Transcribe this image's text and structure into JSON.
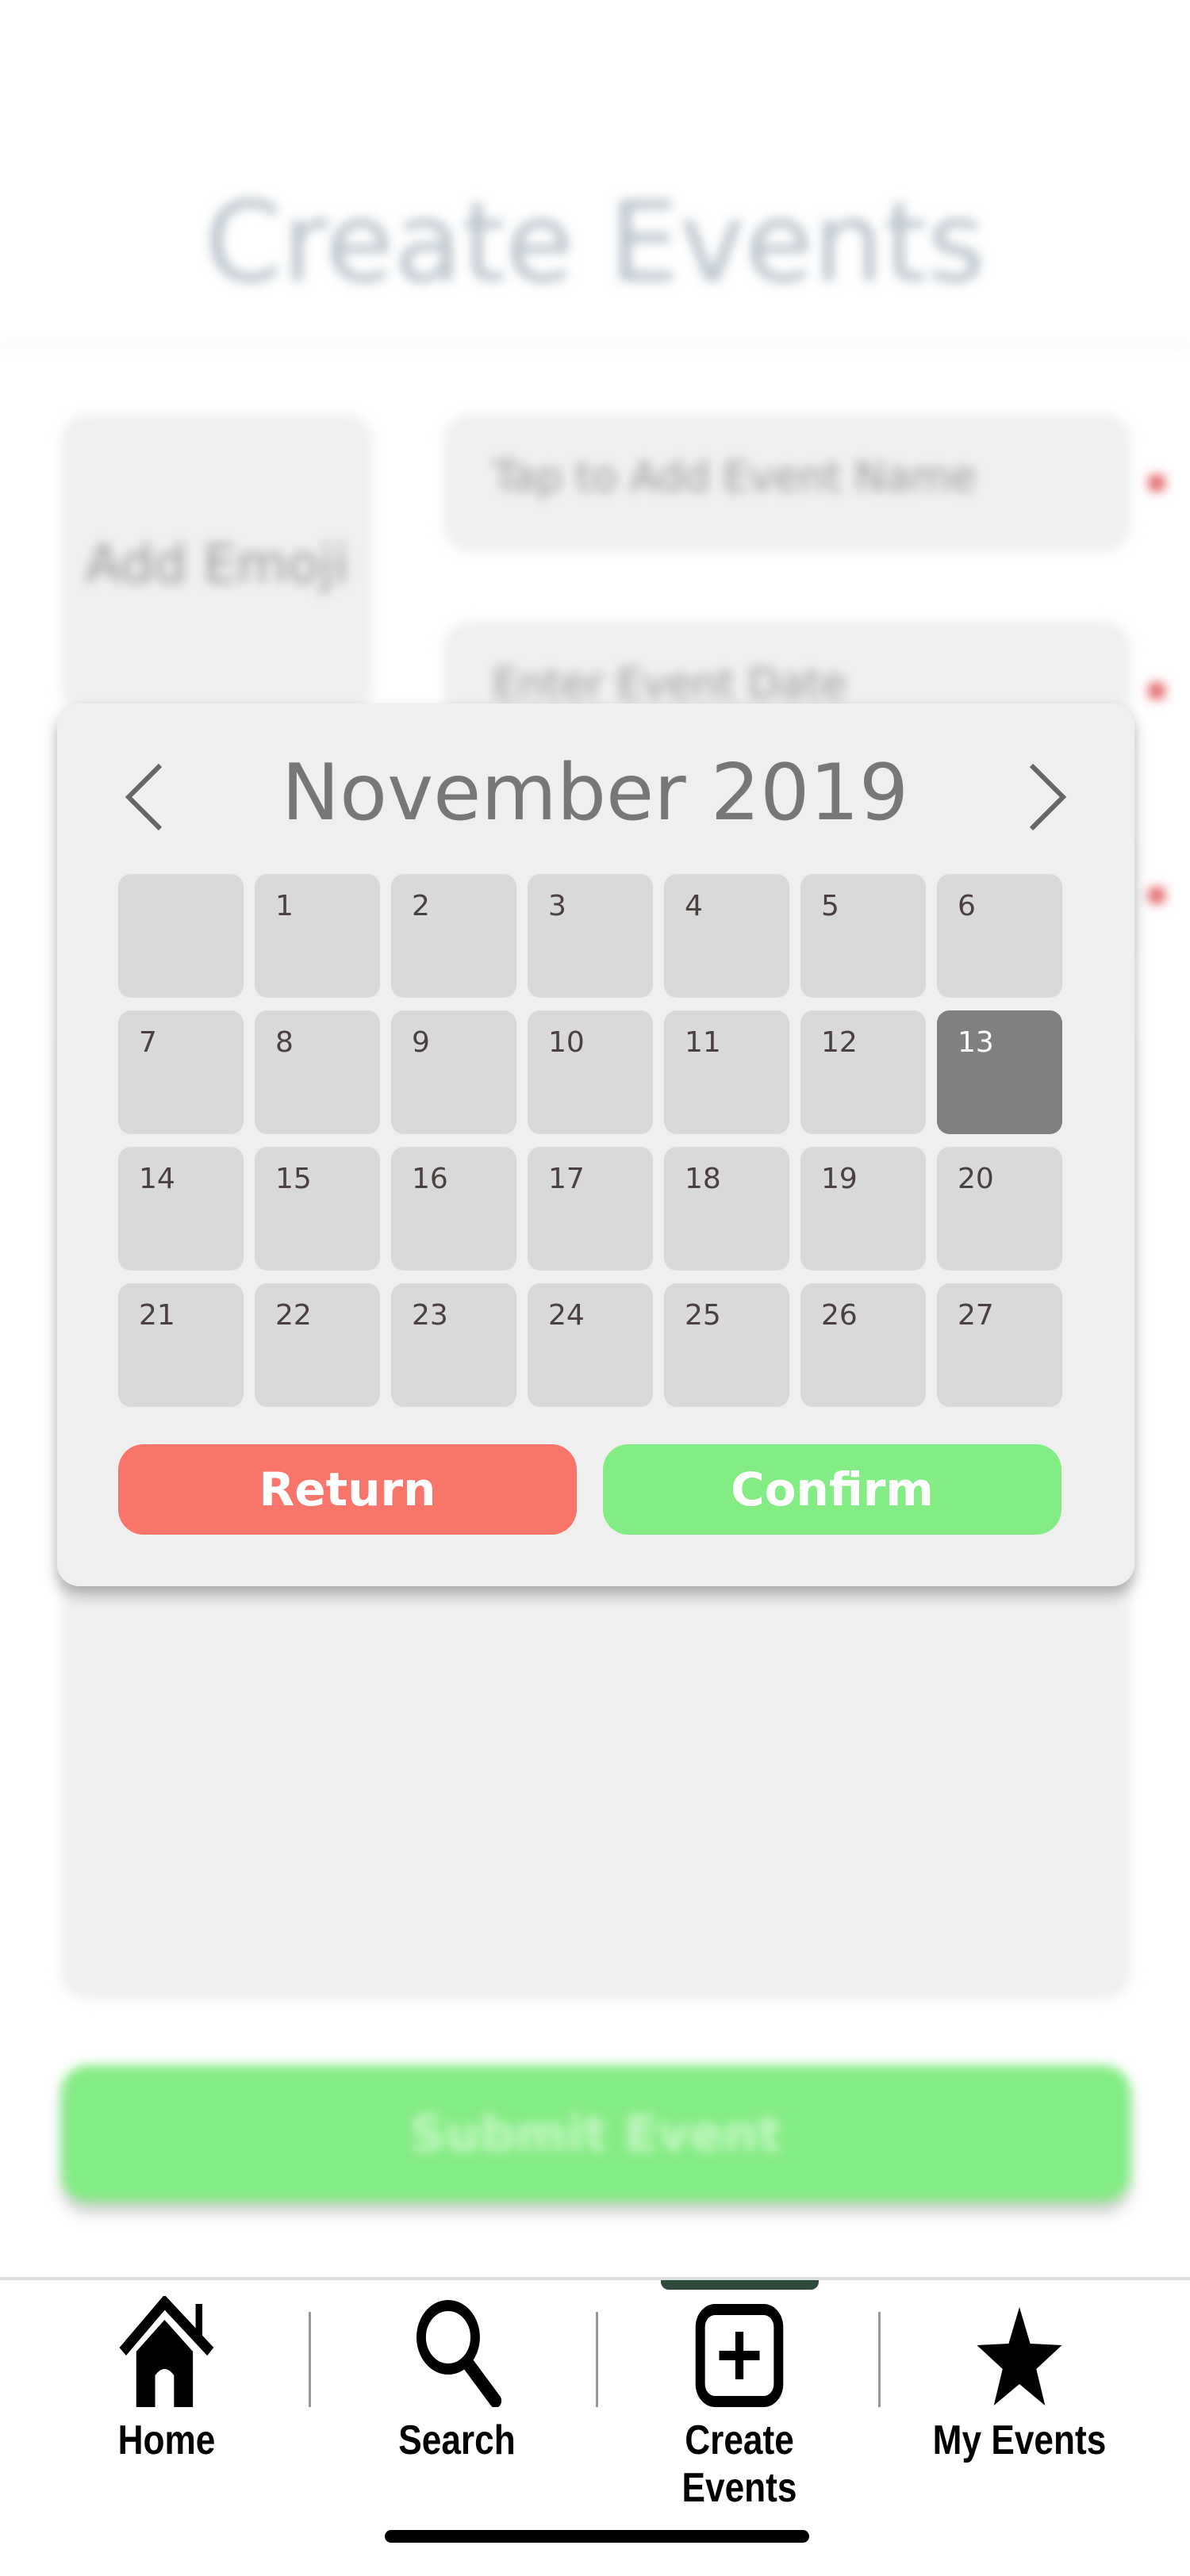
{
  "page": {
    "title": "Create Events"
  },
  "form": {
    "emoji_label": "Add Emoji",
    "event_name_placeholder": "Tap to Add Event Name",
    "event_date_placeholder": "Enter Event Date",
    "submit_label": "Submit Event",
    "required_color": "#e05a5a"
  },
  "calendar": {
    "month_label": "November 2019",
    "prev_icon": "chevron-left-icon",
    "next_icon": "chevron-right-icon",
    "days": [
      "",
      "1",
      "2",
      "3",
      "4",
      "5",
      "6",
      "7",
      "8",
      "9",
      "10",
      "11",
      "12",
      "13",
      "14",
      "15",
      "16",
      "17",
      "18",
      "19",
      "20",
      "21",
      "22",
      "23",
      "24",
      "25",
      "26",
      "27"
    ],
    "selected_day": "13",
    "return_label": "Return",
    "confirm_label": "Confirm",
    "return_color": "#f7756b",
    "confirm_color": "#84ec84"
  },
  "nav": {
    "items": [
      {
        "label": "Home",
        "icon": "home-icon"
      },
      {
        "label": "Search",
        "icon": "search-icon"
      },
      {
        "label": "Create Events",
        "icon": "plus-square-icon",
        "active": true
      },
      {
        "label": "My Events",
        "icon": "star-icon"
      }
    ]
  }
}
